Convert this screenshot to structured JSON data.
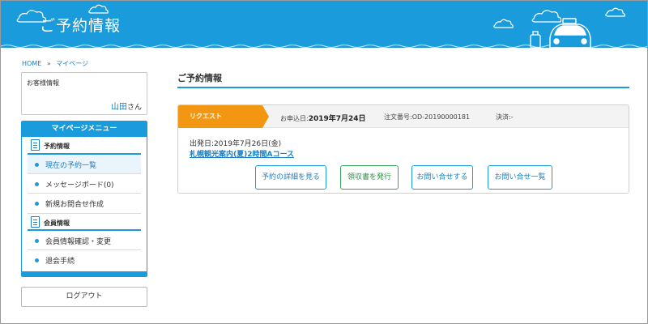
{
  "header": {
    "title": "ご予約情報"
  },
  "breadcrumb": {
    "home": "HOME",
    "separator": "»",
    "mypage": "マイページ"
  },
  "customer": {
    "label": "お客様情報",
    "name": "山田",
    "honorific": "さん"
  },
  "menu": {
    "title": "マイページメニュー",
    "sections": [
      {
        "label": "予約情報",
        "icon": "document-icon",
        "items": [
          "現在の予約一覧",
          "メッセージボード(0)",
          "新規お問合せ作成"
        ]
      },
      {
        "label": "会員情報",
        "icon": "member-card-icon",
        "items": [
          "会員情報確認・変更",
          "退会手続"
        ]
      }
    ]
  },
  "logout_label": "ログアウト",
  "main": {
    "title": "ご予約情報",
    "reservation": {
      "status": "リクエスト",
      "applied_label": "お申込日:",
      "applied_date": "2019年7月24日",
      "order_label": "注文番号:",
      "order_no": "OD-20190000181",
      "payment_label": "決済:",
      "payment_value": "-",
      "depart_label": "出発日:",
      "depart_date": "2019年7月26日(金)",
      "tour_name": "札幌観光案内(夏)2時間Aコース",
      "buttons": [
        "予約の詳細を見る",
        "領収書を発行",
        "お問い合せする",
        "お問い合せ一覧"
      ]
    }
  },
  "colors": {
    "brand_blue": "#1a9bdb",
    "request_orange": "#f39712",
    "receipt_green": "#3aa35a"
  }
}
